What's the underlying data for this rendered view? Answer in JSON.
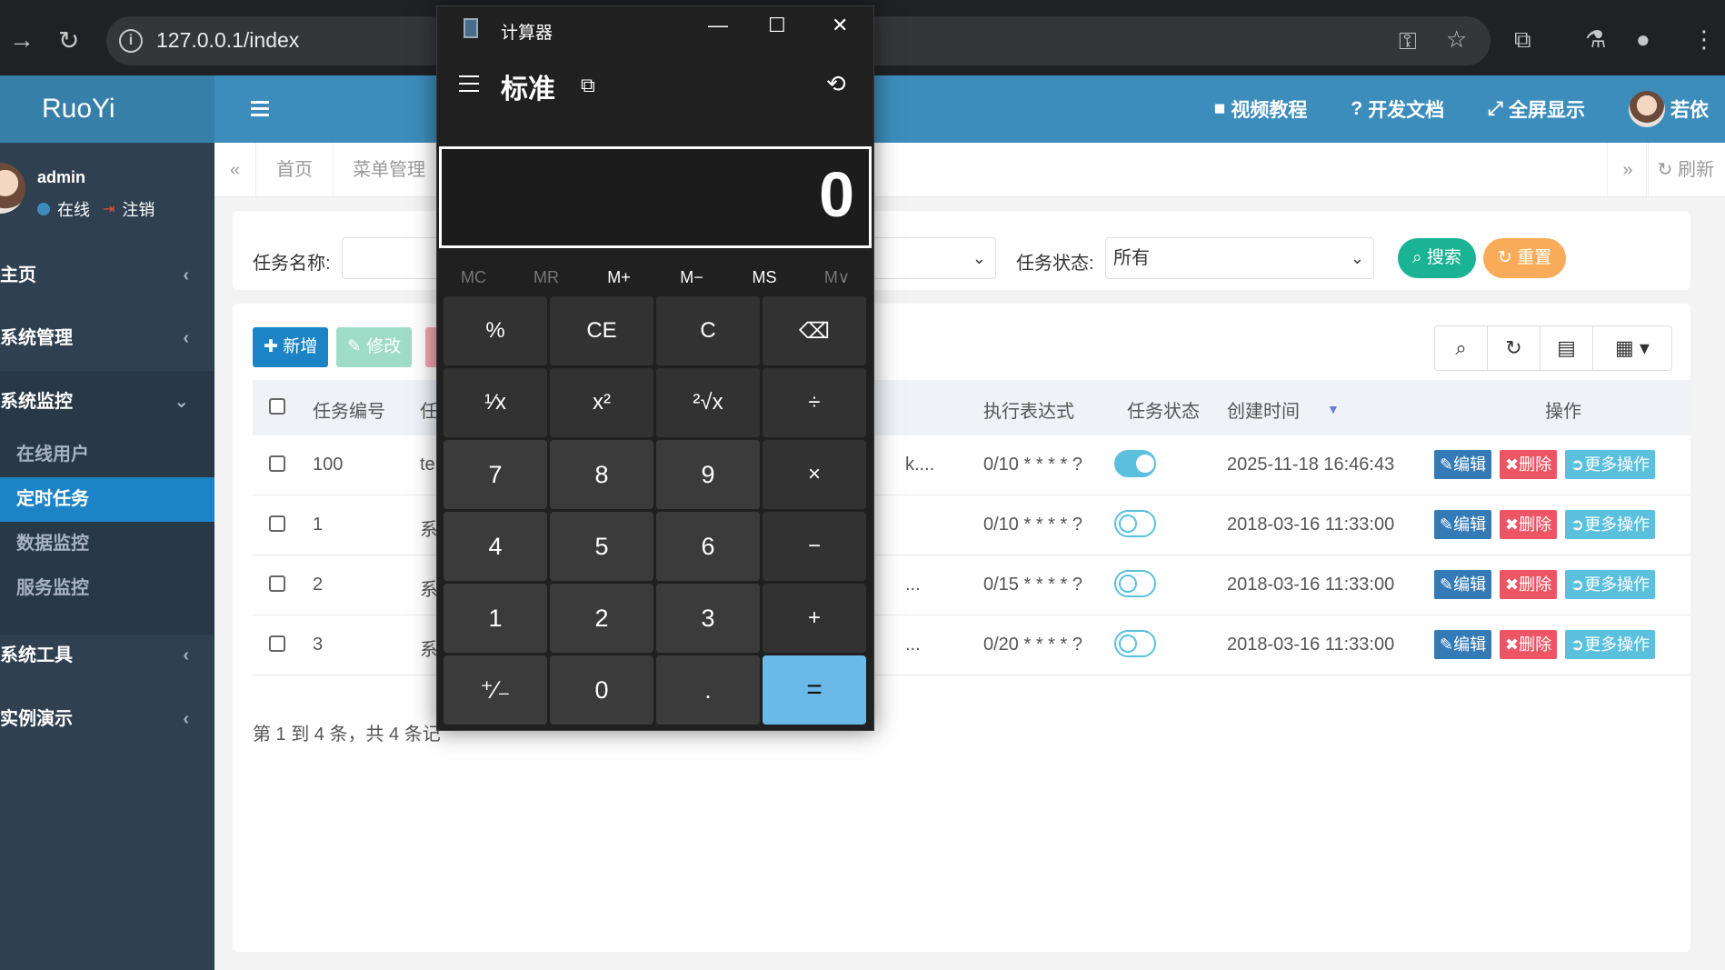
{
  "browser": {
    "url": "127.0.0.1/index",
    "info_icon": "i"
  },
  "app": {
    "logo": "RuoYi",
    "header_links": [
      {
        "label": "视频教程",
        "icon": "video-icon"
      },
      {
        "label": "开发文档",
        "icon": "question-icon"
      },
      {
        "label": "全屏显示",
        "icon": "fullscreen-icon"
      },
      {
        "label": "若依",
        "icon": "avatar"
      }
    ]
  },
  "sidebar": {
    "user": {
      "name": "admin",
      "status": "在线",
      "logout": "注销"
    },
    "menus": [
      {
        "label": "主页"
      },
      {
        "label": "系统管理"
      },
      {
        "label": "系统监控"
      },
      {
        "label": "系统工具"
      },
      {
        "label": "实例演示"
      }
    ],
    "submenu": [
      {
        "label": "在线用户"
      },
      {
        "label": "定时任务"
      },
      {
        "label": "数据监控"
      },
      {
        "label": "服务监控"
      }
    ]
  },
  "tabs": {
    "items": [
      "首页",
      "菜单管理"
    ],
    "refresh": "刷新"
  },
  "search": {
    "task_name_label": "任务名称:",
    "task_status_label": "任务状态:",
    "task_status_value": "所有",
    "search_btn": "搜索",
    "reset_btn": "重置"
  },
  "toolbar": {
    "add": "新增",
    "edit": "修改"
  },
  "table": {
    "headers": {
      "id": "任务编号",
      "name": "任",
      "cron": "执行表达式",
      "status": "任务状态",
      "created": "创建时间",
      "ops": "操作"
    },
    "rows": [
      {
        "id": "100",
        "name": "te",
        "target": "k....",
        "cron": "0/10 * * * * ?",
        "enabled": true,
        "created": "2025-11-18 16:46:43"
      },
      {
        "id": "1",
        "name": "系",
        "target": "",
        "cron": "0/10 * * * * ?",
        "enabled": false,
        "created": "2018-03-16 11:33:00"
      },
      {
        "id": "2",
        "name": "系",
        "target": "...",
        "cron": "0/15 * * * * ?",
        "enabled": false,
        "created": "2018-03-16 11:33:00"
      },
      {
        "id": "3",
        "name": "系",
        "target": "...",
        "cron": "0/20 * * * * ?",
        "enabled": false,
        "created": "2018-03-16 11:33:00"
      }
    ],
    "row_actions": {
      "edit": "编辑",
      "delete": "删除",
      "more": "更多操作"
    },
    "pager_text": "第 1 到 4 条，共 4 条记"
  },
  "calculator": {
    "title": "计算器",
    "mode": "标准",
    "display": "0",
    "memory": [
      "MC",
      "MR",
      "M+",
      "M−",
      "MS",
      "M∨"
    ],
    "keys": [
      "%",
      "CE",
      "C",
      "⌫",
      "¹∕x",
      "x²",
      "²√x",
      "÷",
      "7",
      "8",
      "9",
      "×",
      "4",
      "5",
      "6",
      "−",
      "1",
      "2",
      "3",
      "+",
      "⁺∕₋",
      "0",
      ".",
      "="
    ]
  },
  "colors": {
    "header": "#3c8dbc",
    "sidebar": "#2f4050",
    "primary_btn": "#1c84c6",
    "edit_btn": "#337ab7",
    "delete_btn": "#ed5565",
    "more_btn": "#5bc0de",
    "search_btn": "#1ab394",
    "reset_btn": "#f8ac59",
    "calc_equals": "#6ab9e8"
  }
}
